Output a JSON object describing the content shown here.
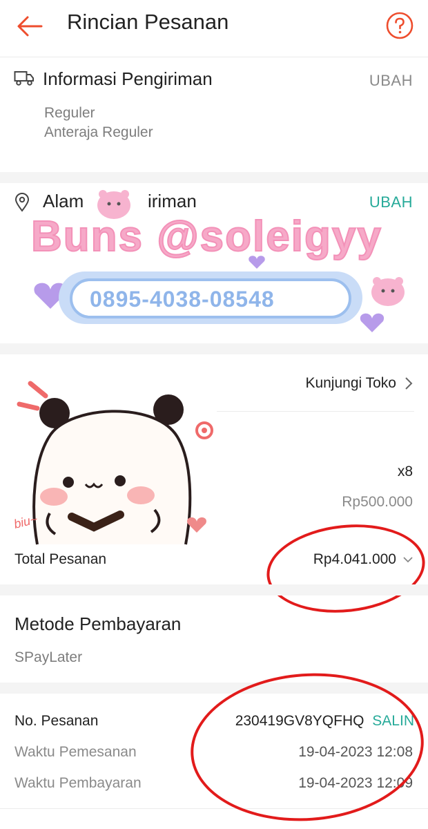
{
  "header": {
    "title": "Rincian Pesanan"
  },
  "shipping_info": {
    "title": "Informasi Pengiriman",
    "action": "UBAH",
    "service": "Reguler",
    "courier": "Anteraja Reguler"
  },
  "address": {
    "title_left": "Alam",
    "title_right": "iriman",
    "action": "UBAH"
  },
  "watermark": {
    "text": "Buns @soleigyy",
    "phone": "0895-4038-08548",
    "small_text": "biu~"
  },
  "order": {
    "visit_shop": "Kunjungi Toko",
    "quantity": "x8",
    "unit_price": "Rp500.000",
    "total_label": "Total Pesanan",
    "total_value": "Rp4.041.000"
  },
  "payment": {
    "title": "Metode Pembayaran",
    "method": "SPayLater"
  },
  "details": {
    "order_no_label": "No. Pesanan",
    "order_no_value": "230419GV8YQFHQ",
    "copy_label": "SALIN",
    "order_time_label": "Waktu Pemesanan",
    "order_time_value": "19-04-2023 12:08",
    "pay_time_label": "Waktu Pembayaran",
    "pay_time_value": "19-04-2023 12:09"
  },
  "colors": {
    "accent": "#ee4d2d",
    "teal": "#26aa99",
    "annotation": "#e21b1b",
    "watermark_pink": "#f6a9c8",
    "watermark_blue": "#a9c8ef"
  }
}
